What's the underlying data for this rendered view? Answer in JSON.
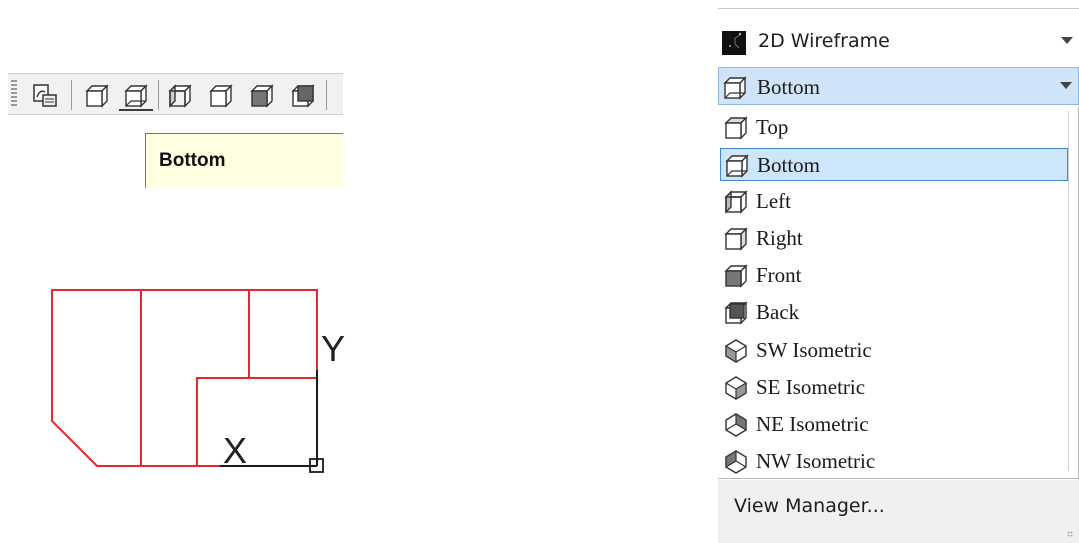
{
  "tooltip": {
    "text": "Bottom"
  },
  "drawing": {
    "axis_x": "X",
    "axis_y": "Y"
  },
  "toolbar": {
    "buttons": [
      "named-views-icon",
      "top-view-icon",
      "bottom-view-icon",
      "left-view-icon",
      "right-view-icon",
      "front-view-icon",
      "back-view-icon"
    ],
    "active": "bottom-view-icon"
  },
  "visual_style": {
    "label": "2D Wireframe"
  },
  "view_combo": {
    "label": "Bottom"
  },
  "views": [
    {
      "label": "Top",
      "icon": "top-view-icon"
    },
    {
      "label": "Bottom",
      "icon": "bottom-view-icon",
      "selected": true
    },
    {
      "label": "Left",
      "icon": "left-view-icon"
    },
    {
      "label": "Right",
      "icon": "right-view-icon"
    },
    {
      "label": "Front",
      "icon": "front-view-icon"
    },
    {
      "label": "Back",
      "icon": "back-view-icon"
    },
    {
      "label": "SW Isometric",
      "icon": "sw-isometric-icon"
    },
    {
      "label": "SE Isometric",
      "icon": "se-isometric-icon"
    },
    {
      "label": "NE Isometric",
      "icon": "ne-isometric-icon"
    },
    {
      "label": "NW Isometric",
      "icon": "nw-isometric-icon"
    }
  ],
  "footer": {
    "label": "View Manager..."
  },
  "colors": {
    "drawing_lines": "#e8262b",
    "ucs": "#1a1a1a",
    "selection": "#cde6fb",
    "tooltip_bg": "#ffffe1"
  }
}
